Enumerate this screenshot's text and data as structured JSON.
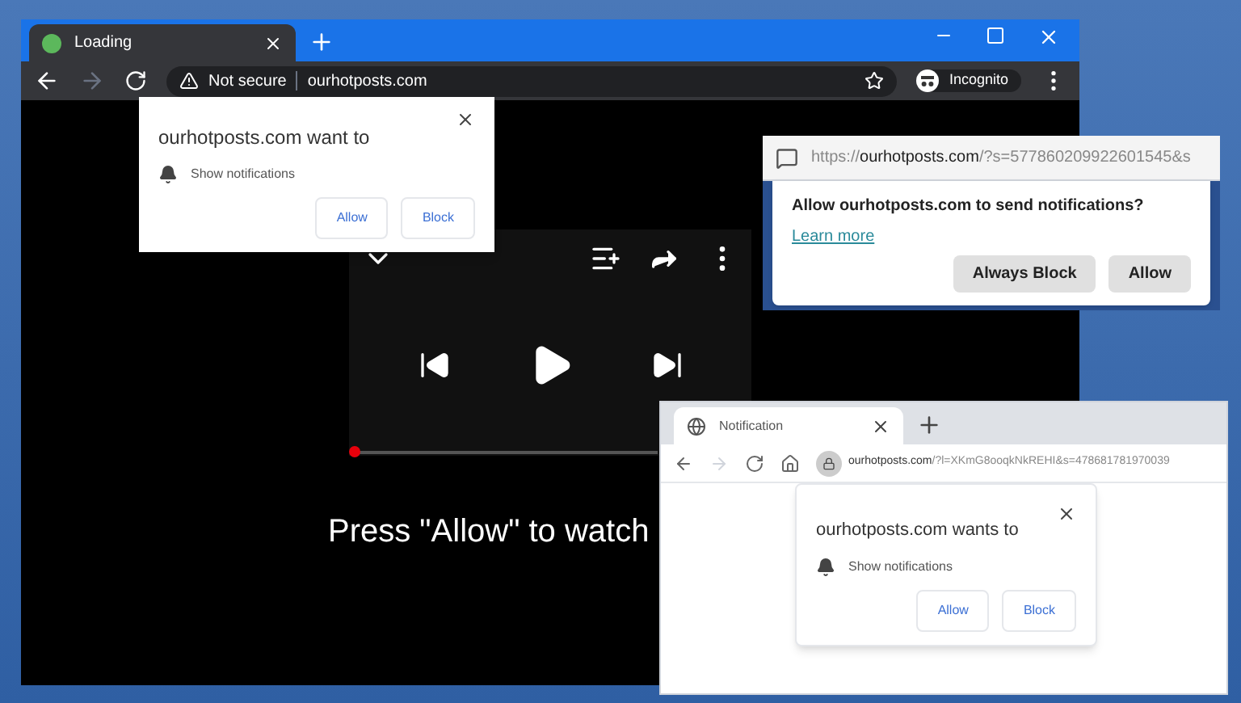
{
  "chrome_window": {
    "tab": {
      "title": "Loading",
      "selected": true
    },
    "address": {
      "security": "Not secure",
      "url": "ourhotposts.com"
    },
    "profile": "Incognito",
    "prompt": {
      "title": "ourhotposts.com want to",
      "permission": "Show notifications",
      "buttons": [
        "Allow",
        "Block"
      ]
    },
    "player": {
      "level": 0
    },
    "caption": "Press \"Allow\" to watch"
  },
  "firefox_window": {
    "url_prefix": "https://",
    "url_host": "ourhotposts.com",
    "url_rest": "/?s=577860209922601545&s",
    "prompt": {
      "title": "Allow ourhotposts.com to send notifications?",
      "link": "Learn more",
      "buttons": [
        "Always Block",
        "Allow"
      ]
    }
  },
  "notification_window": {
    "tab": {
      "title": "Notification",
      "selected": true
    },
    "url_host": "ourhotposts.com",
    "url_rest": "/?l=XKmG8ooqkNkREHI&s=478681781970039",
    "prompt": {
      "title": "ourhotposts.com wants to",
      "permission": "Show notifications",
      "buttons": [
        "Allow",
        "Block"
      ]
    }
  }
}
